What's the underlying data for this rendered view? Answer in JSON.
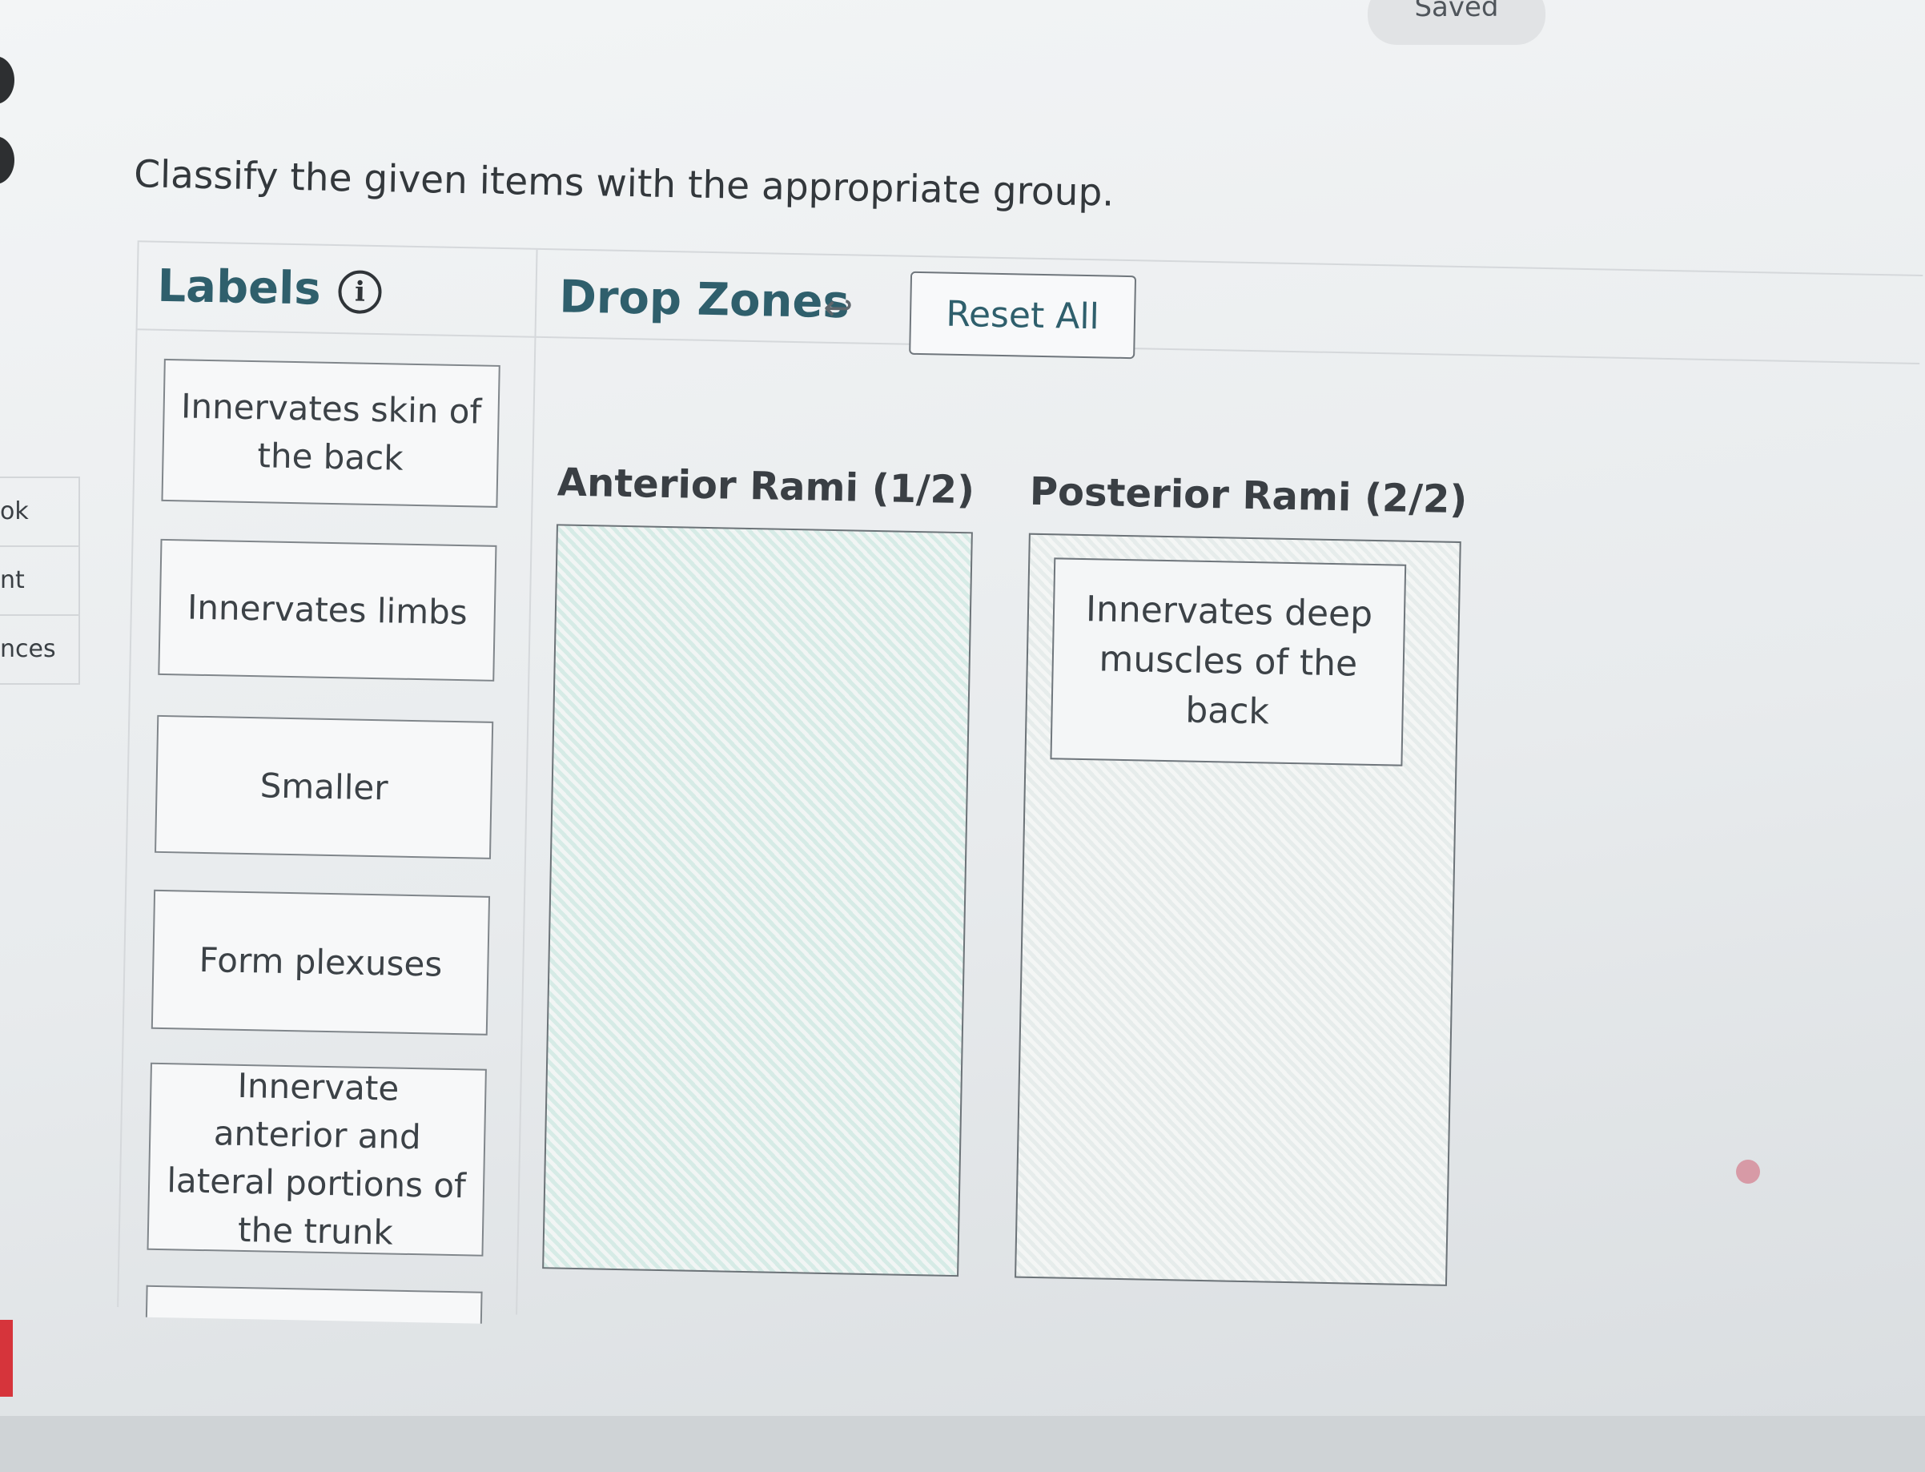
{
  "status": {
    "saved_label": "Saved"
  },
  "sidebar": {
    "items": [
      "ok",
      "nt",
      "nces"
    ]
  },
  "question": {
    "prompt": "Classify the given items with the appropriate group."
  },
  "labels_panel": {
    "title": "Labels",
    "info_icon": "info-circle-icon",
    "items": [
      "Innervates skin of the back",
      "Innervates limbs",
      "Smaller",
      "Form plexuses",
      "Innervate anterior and lateral portions of the trunk"
    ]
  },
  "drop_zones_panel": {
    "title": "Drop Zones",
    "undo_icon": "undo-arrow-icon",
    "reset_label": "Reset All",
    "zones": [
      {
        "title": "Anterior Rami (1/2)",
        "items": []
      },
      {
        "title": "Posterior Rami (2/2)",
        "items": [
          "Innervates deep muscles of the back"
        ]
      }
    ]
  },
  "colors": {
    "heading": "#2f5f6c",
    "card_border": "#80868b",
    "anterior_zone_tint": "#d6ebe6",
    "sidebar_accent": "#d6343b"
  }
}
